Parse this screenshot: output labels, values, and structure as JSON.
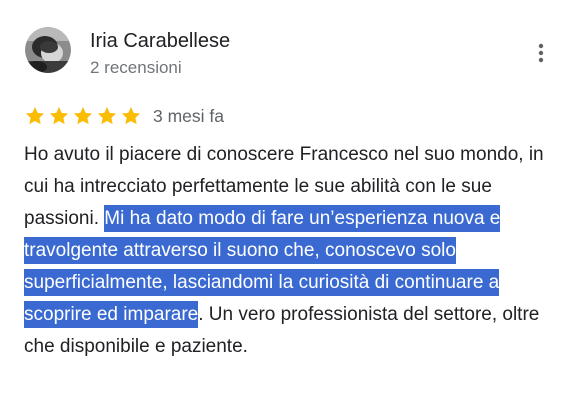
{
  "review": {
    "author_name": "Iria Carabellese",
    "author_meta": "2 recensioni",
    "rating": 5,
    "rating_max": 5,
    "date": "3 mesi fa",
    "text_before": "Ho avuto il piacere di conoscere Francesco nel suo mondo, in cui ha intrecciato perfettamente le sue abilità con le sue passioni. ",
    "text_highlighted": "Mi ha dato modo di fare un’esperienza nuova e travolgente attraverso il suono che, conoscevo solo superficialmente, lasciandomi la curiosità di continuare a scoprire ed imparare",
    "text_after": ". Un vero professionista del settore, oltre che disponibile e paziente."
  },
  "icons": {
    "star": "star-icon",
    "more": "more-vertical-icon",
    "avatar": "avatar"
  },
  "colors": {
    "star": "#fbbc04",
    "selection_bg": "#3a6ad1",
    "selection_text": "#ffffff",
    "secondary_text": "#70757a",
    "primary_text": "#202124"
  }
}
